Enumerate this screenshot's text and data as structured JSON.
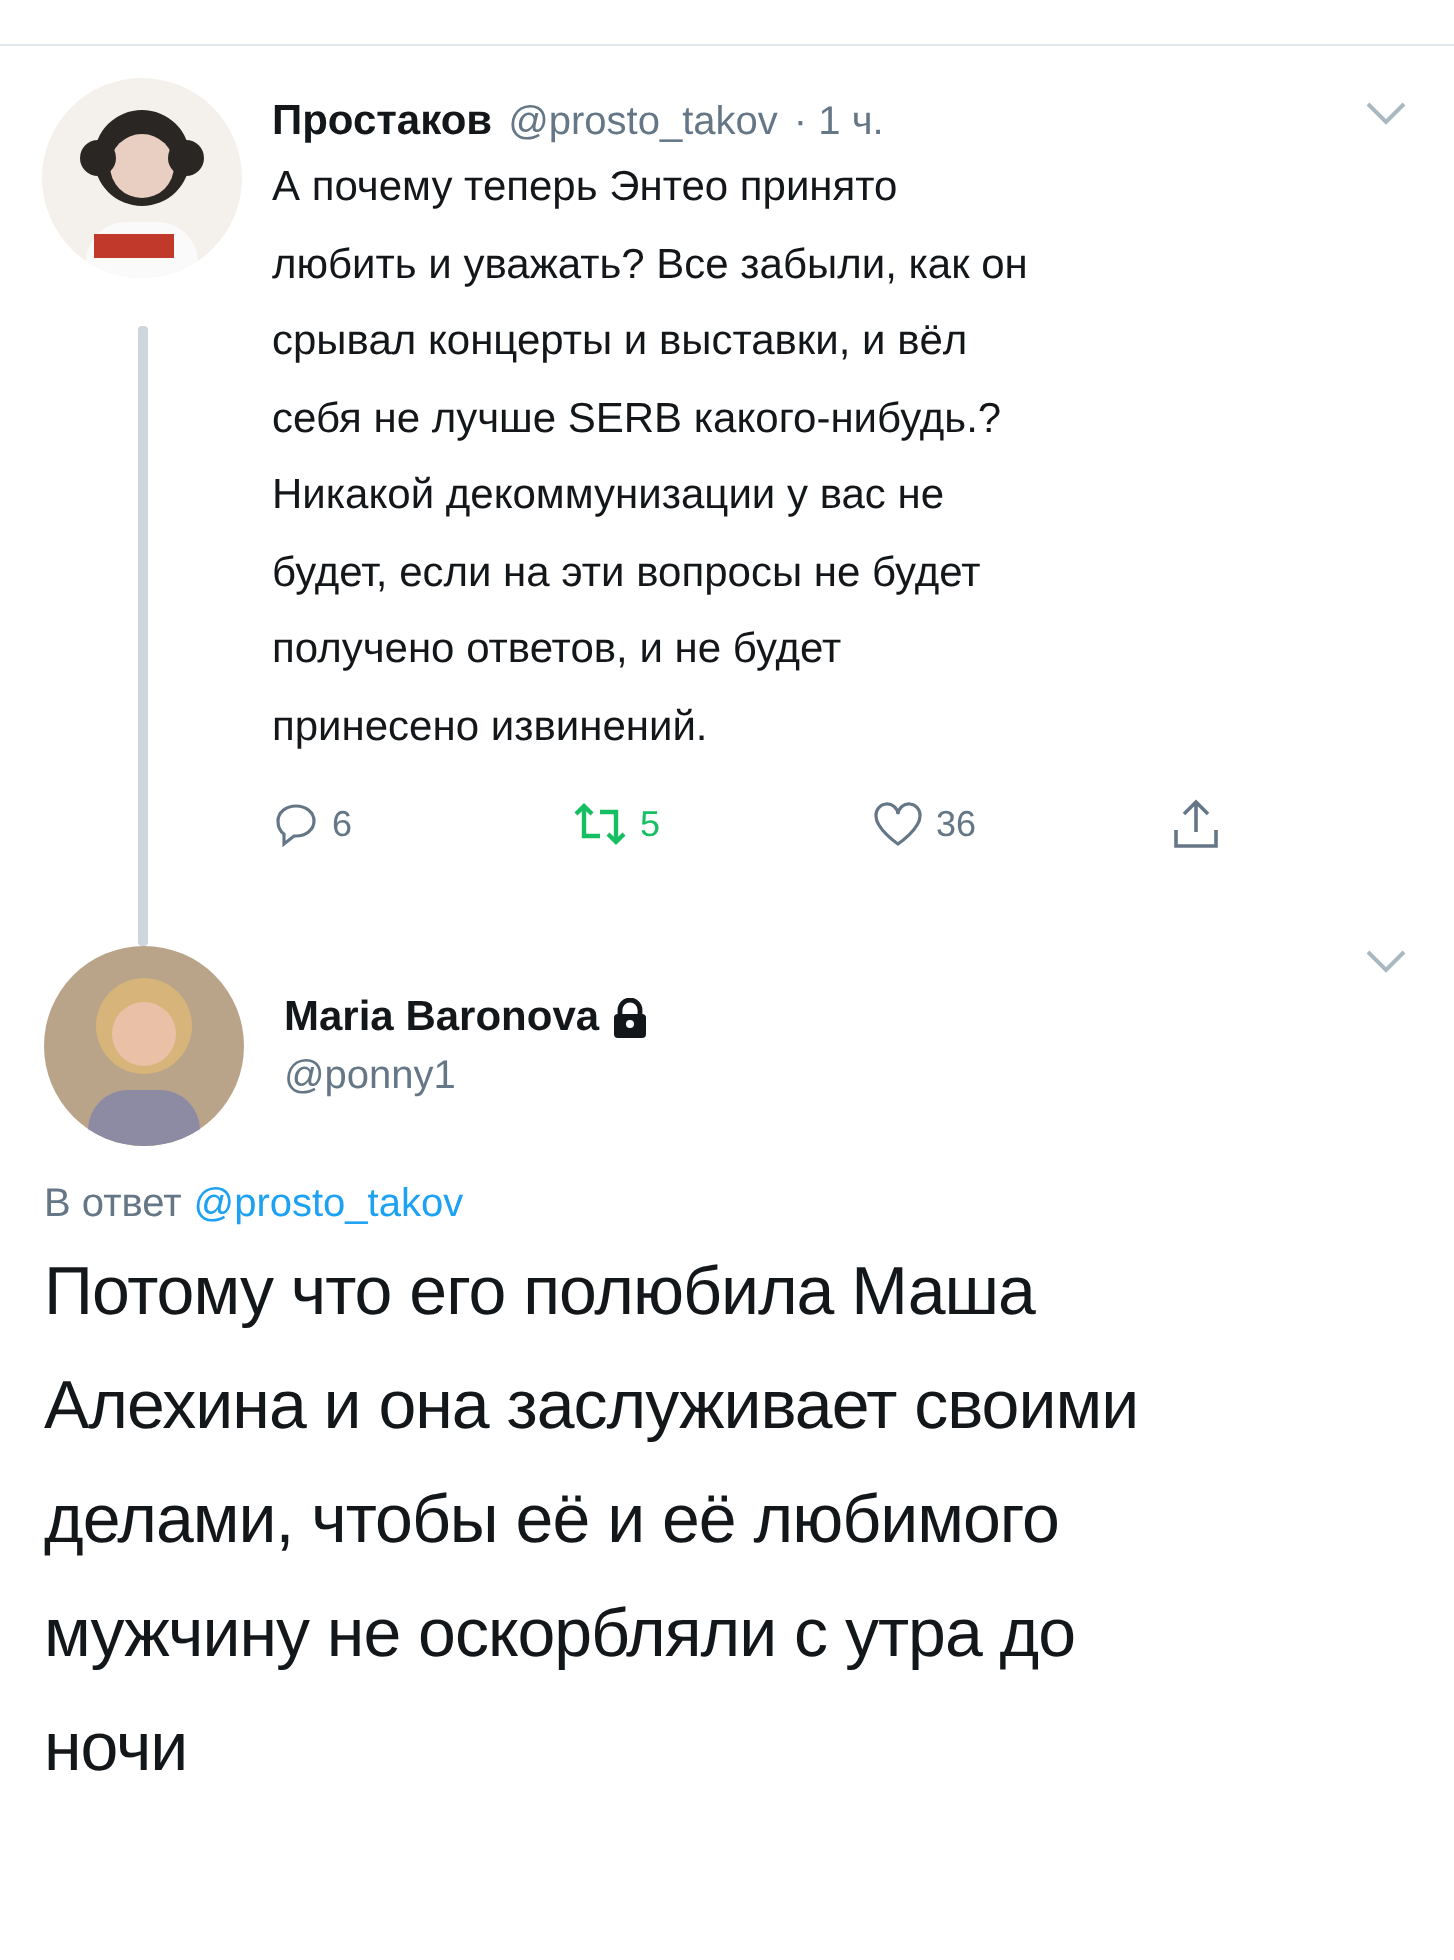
{
  "tweets": [
    {
      "kind": "thread",
      "author": {
        "name": "Простаков",
        "handle": "@prosto_takov",
        "time": "· 1 ч."
      },
      "text": "А почему теперь Энтео принято\nлюбить и уважать? Все забыли, как он\nсрывал концерты и выставки, и вёл\nсебя не лучше SERB какого-нибудь.?\nНикакой декоммунизации у вас не\nбудет, если на эти вопросы не будет\nполучено ответов, и не будет\nпринесено извинений.",
      "actions": {
        "replies": "6",
        "retweets": "5",
        "retweeted": true,
        "likes": "36",
        "liked": false
      }
    },
    {
      "kind": "focus",
      "author": {
        "name": "Maria Baronova",
        "handle": "@ponny1",
        "locked": true
      },
      "reply_to": {
        "label": "В ответ",
        "handle": "@prosto_takov"
      },
      "text": "Потому что его полюбила Маша\nАлехина и она заслуживает своими\nделами, чтобы её и её любимого\nмужчину не оскорбляли с утра до\nночи"
    }
  ]
}
